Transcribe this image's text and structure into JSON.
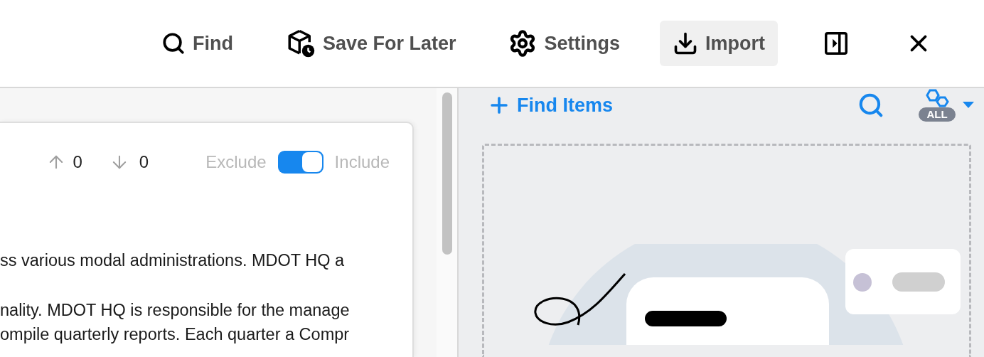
{
  "toolbar": [
    {
      "kind": "find",
      "label": "Find",
      "highlighted": false
    },
    {
      "kind": "save",
      "label": "Save For Later",
      "highlighted": false
    },
    {
      "kind": "settings",
      "label": "Settings",
      "highlighted": false
    },
    {
      "kind": "import",
      "label": "Import",
      "highlighted": true
    }
  ],
  "card": {
    "upvotes": "0",
    "downvotes": "0",
    "toggle": {
      "off_label": "Exclude",
      "on_label": "Include",
      "on": true
    },
    "paragraphs": [
      [
        "ss various modal administrations. MDOT HQ a"
      ],
      [
        "nality. MDOT HQ is responsible for the manage",
        "ompile quarterly reports. Each quarter a Compr"
      ]
    ]
  },
  "right_panel": {
    "add_label": "Find Items",
    "filter_badge": "ALL"
  }
}
